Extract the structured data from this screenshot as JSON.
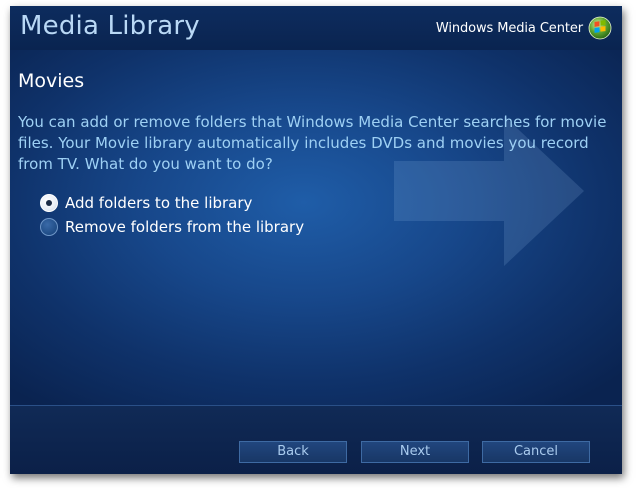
{
  "header": {
    "title": "Media Library",
    "brand_text": "Windows Media Center",
    "brand_icon": "windows-logo-icon"
  },
  "main": {
    "section_title": "Movies",
    "description": "You can add or remove folders that Windows Media Center searches for movie files. Your Movie library automatically includes DVDs and movies you record from TV.  What do you want to do?",
    "options": [
      {
        "label": "Add folders to the library",
        "selected": true
      },
      {
        "label": "Remove folders from the library",
        "selected": false
      }
    ]
  },
  "footer": {
    "back_label": "Back",
    "next_label": "Next",
    "cancel_label": "Cancel"
  },
  "colors": {
    "background": "#17478a",
    "title_text": "#b9d8f5",
    "description_text": "#9ed0f4",
    "button_text": "#a9cbee"
  }
}
